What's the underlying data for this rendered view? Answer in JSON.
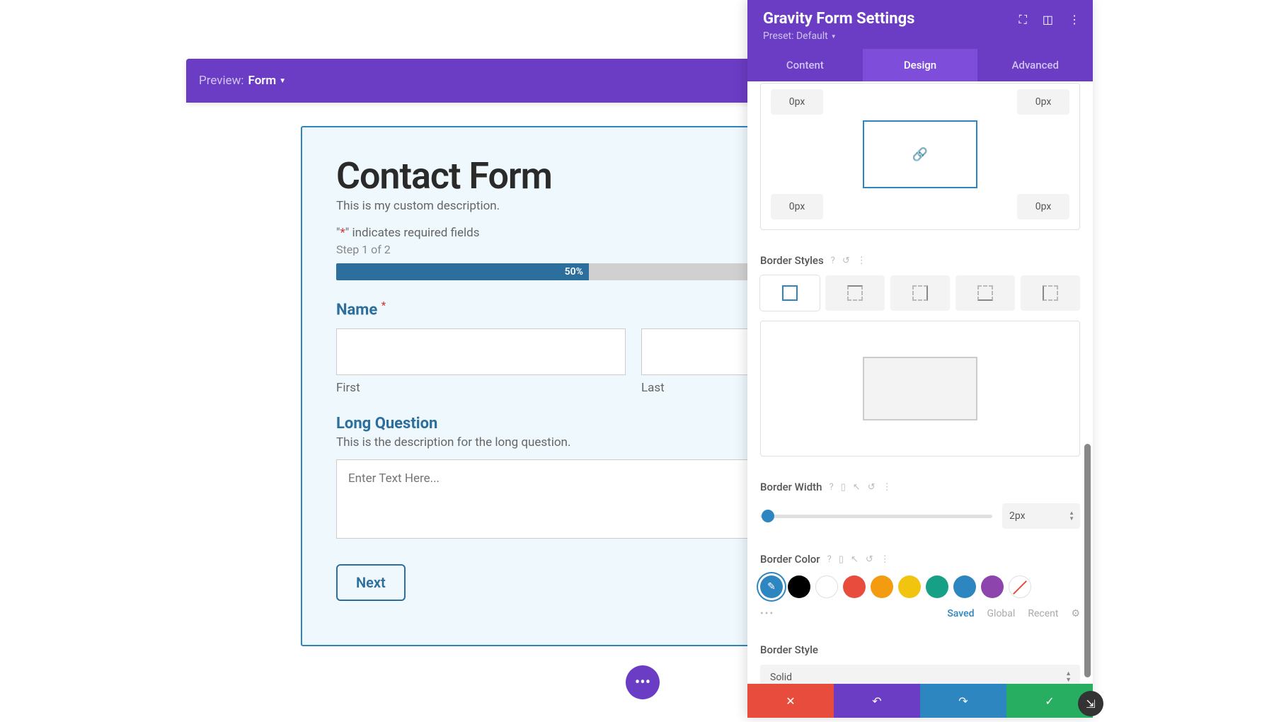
{
  "preview": {
    "label": "Preview:",
    "form": "Form"
  },
  "form": {
    "title": "Contact Form",
    "description": "This is my custom description.",
    "required_note_pre": "\"",
    "required_ast": "*",
    "required_note_post": "\" indicates required fields",
    "step": "Step 1 of 2",
    "progress_pct": "50%",
    "name_label": "Name",
    "first": "First",
    "last": "Last",
    "long_label": "Long Question",
    "long_desc": "This is the description for the long question.",
    "textarea_ph": "Enter Text Here...",
    "next": "Next"
  },
  "panel": {
    "title": "Gravity Form Settings",
    "preset": "Preset: Default",
    "tabs": {
      "content": "Content",
      "design": "Design",
      "advanced": "Advanced"
    },
    "margin": {
      "tl": "0px",
      "tr": "0px",
      "bl": "0px",
      "br": "0px"
    },
    "border_styles": "Border Styles",
    "border_width": {
      "label": "Border Width",
      "value": "2px"
    },
    "border_color": {
      "label": "Border Color",
      "swatches": [
        "#000000",
        "#ffffff",
        "#e74c3c",
        "#f39c12",
        "#f1c40f",
        "#16a085",
        "#2e86c1",
        "#8e44ad"
      ],
      "saved": "Saved",
      "global": "Global",
      "recent": "Recent"
    },
    "border_style": {
      "label": "Border Style",
      "value": "Solid"
    }
  }
}
